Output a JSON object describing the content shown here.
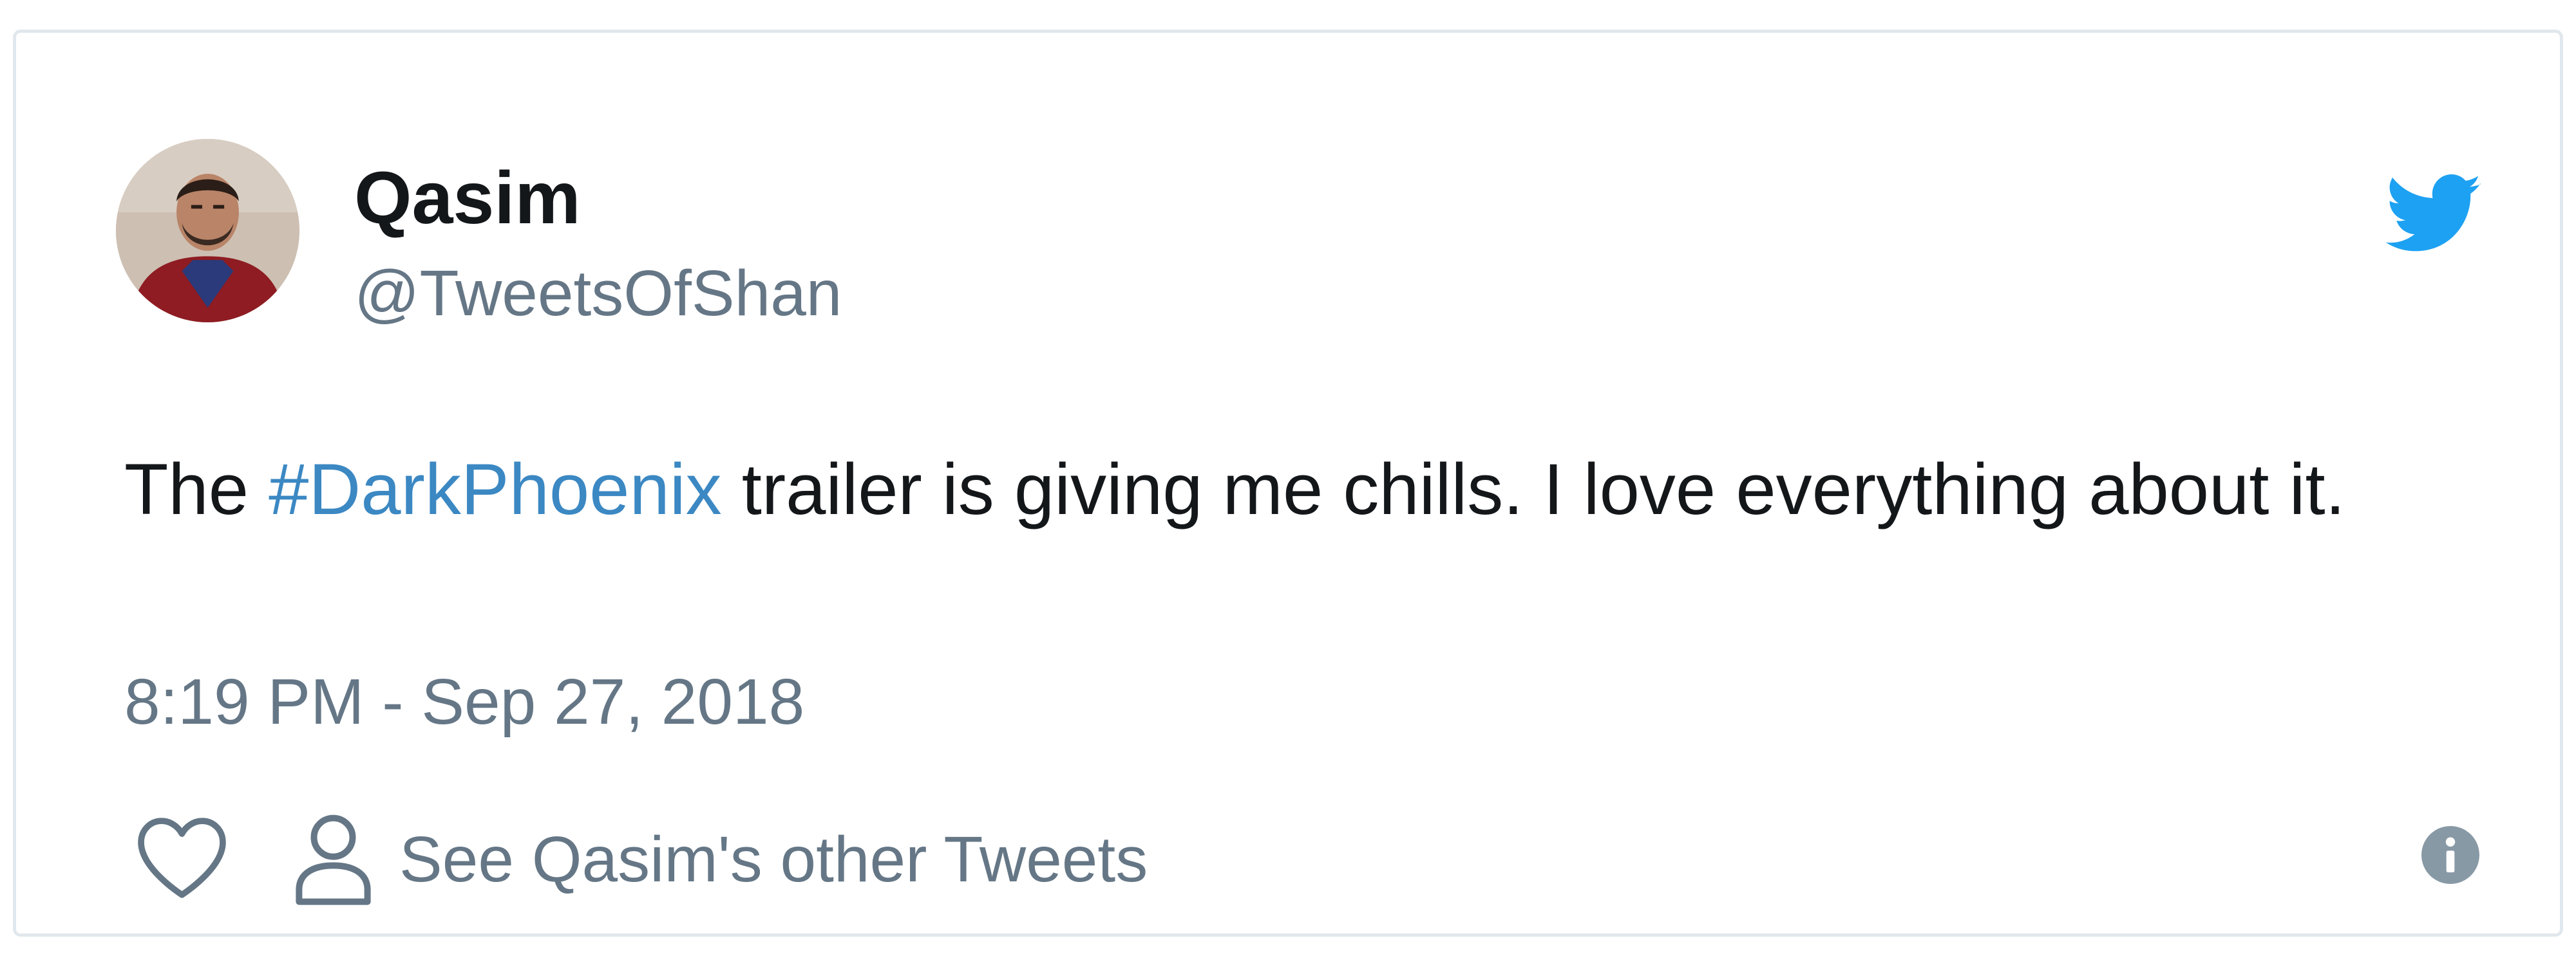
{
  "tweet": {
    "author_name": "Qasim",
    "author_handle": "@TweetsOfShan",
    "text_before": "The ",
    "hashtag": "#DarkPhoenix",
    "text_after": " trailer is giving me chills. I love everything about it.",
    "timestamp": "8:19 PM - Sep 27, 2018"
  },
  "actions": {
    "like_icon": "heart-icon",
    "other_tweets_label": "See Qasim's other Tweets",
    "other_tweets_icon": "person-icon",
    "info_icon": "info-icon"
  },
  "brand": {
    "icon": "twitter-bird-icon",
    "color": "#1da1f2"
  },
  "colors": {
    "hashtag": "#3b88c3",
    "muted_text": "#657786",
    "primary_text": "#14171a",
    "border": "#e1e8ed"
  }
}
